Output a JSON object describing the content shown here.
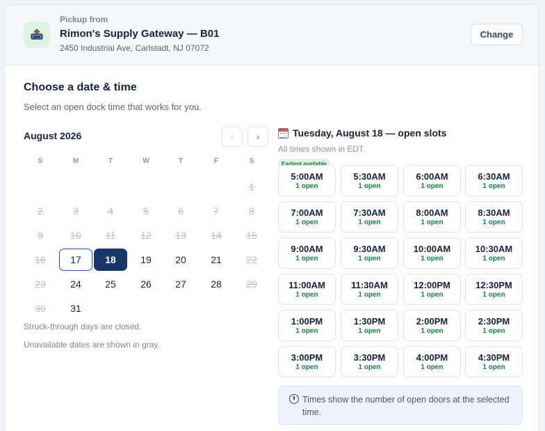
{
  "pickup": {
    "label": "Pickup from",
    "name": "Rimon's Supply Gateway — B01",
    "address": "2450 Industrial Ave, Carlstadt, NJ 07072",
    "icon": "warehouse-icon",
    "change_label": "Change"
  },
  "heading": {
    "title": "Choose a date & time",
    "subtitle": "Select an open dock time that works for you."
  },
  "calendar": {
    "month_label": "August 2026",
    "prev_icon": "‹",
    "next_icon": "›",
    "weekdays": [
      "S",
      "M",
      "T",
      "W",
      "T",
      "F",
      "S"
    ],
    "days": [
      {
        "d": "1",
        "state": "closed"
      },
      {
        "d": "2",
        "state": "closed"
      },
      {
        "d": "3",
        "state": "closed"
      },
      {
        "d": "4",
        "state": "closed"
      },
      {
        "d": "5",
        "state": "closed"
      },
      {
        "d": "6",
        "state": "closed"
      },
      {
        "d": "7",
        "state": "closed"
      },
      {
        "d": "8",
        "state": "closed"
      },
      {
        "d": "9",
        "state": "closed"
      },
      {
        "d": "10",
        "state": "closed"
      },
      {
        "d": "11",
        "state": "closed"
      },
      {
        "d": "12",
        "state": "closed"
      },
      {
        "d": "13",
        "state": "closed"
      },
      {
        "d": "14",
        "state": "closed"
      },
      {
        "d": "15",
        "state": "closed"
      },
      {
        "d": "16",
        "state": "closed"
      },
      {
        "d": "17",
        "state": "today"
      },
      {
        "d": "18",
        "state": "selected"
      },
      {
        "d": "19",
        "state": "open"
      },
      {
        "d": "20",
        "state": "open"
      },
      {
        "d": "21",
        "state": "open"
      },
      {
        "d": "22",
        "state": "closed"
      },
      {
        "d": "23",
        "state": "closed"
      },
      {
        "d": "24",
        "state": "open"
      },
      {
        "d": "25",
        "state": "open"
      },
      {
        "d": "26",
        "state": "open"
      },
      {
        "d": "27",
        "state": "open"
      },
      {
        "d": "28",
        "state": "open"
      },
      {
        "d": "29",
        "state": "closed"
      },
      {
        "d": "30",
        "state": "closed"
      },
      {
        "d": "31",
        "state": "open"
      }
    ],
    "notes": [
      "Struck-through days are closed.",
      "Unavailable dates are shown in gray."
    ]
  },
  "slots": {
    "title": "Tuesday, August 18 — open slots",
    "subtitle": "All times shown in EDT.",
    "badge": "Earliest available",
    "items": [
      {
        "time": "5:00AM",
        "open": "1 open"
      },
      {
        "time": "5:30AM",
        "open": "1 open"
      },
      {
        "time": "6:00AM",
        "open": "1 open"
      },
      {
        "time": "6:30AM",
        "open": "1 open"
      },
      {
        "time": "7:00AM",
        "open": "1 open"
      },
      {
        "time": "7:30AM",
        "open": "1 open"
      },
      {
        "time": "8:00AM",
        "open": "1 open"
      },
      {
        "time": "8:30AM",
        "open": "1 open"
      },
      {
        "time": "9:00AM",
        "open": "1 open"
      },
      {
        "time": "9:30AM",
        "open": "1 open"
      },
      {
        "time": "10:00AM",
        "open": "1 open"
      },
      {
        "time": "10:30AM",
        "open": "1 open"
      },
      {
        "time": "11:00AM",
        "open": "1 open"
      },
      {
        "time": "11:30AM",
        "open": "1 open"
      },
      {
        "time": "12:00PM",
        "open": "1 open"
      },
      {
        "time": "12:30PM",
        "open": "1 open"
      },
      {
        "time": "1:00PM",
        "open": "1 open"
      },
      {
        "time": "1:30PM",
        "open": "1 open"
      },
      {
        "time": "2:00PM",
        "open": "1 open"
      },
      {
        "time": "2:30PM",
        "open": "1 open"
      },
      {
        "time": "3:00PM",
        "open": "1 open"
      },
      {
        "time": "3:30PM",
        "open": "1 open"
      },
      {
        "time": "4:00PM",
        "open": "1 open"
      },
      {
        "time": "4:30PM",
        "open": "1 open"
      }
    ],
    "info": "Times show the number of open doors at the selected time."
  },
  "colors": {
    "accent": "#1a3668",
    "open_green": "#1f7a45",
    "badge_bg": "#def3e6",
    "info_bg": "#edf2fc"
  }
}
